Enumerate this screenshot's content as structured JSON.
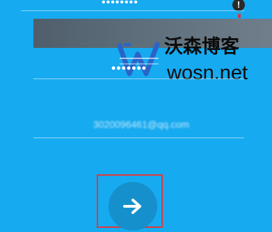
{
  "login": {
    "password_mask_top": "••••••••",
    "password_mask": "•••••••",
    "email": "3020096461@qq.com"
  },
  "alert": {
    "symbol": "!"
  },
  "watermark": {
    "title": "沃森博客",
    "url": "wosn.net"
  },
  "icons": {
    "alert": "exclamation-circle-icon",
    "next": "arrow-right-icon",
    "logo": "w-logo-icon"
  },
  "colors": {
    "background": "#16aaf0",
    "button": "#1590cc",
    "highlight": "#e03838",
    "banner": "#5e6f7b"
  }
}
